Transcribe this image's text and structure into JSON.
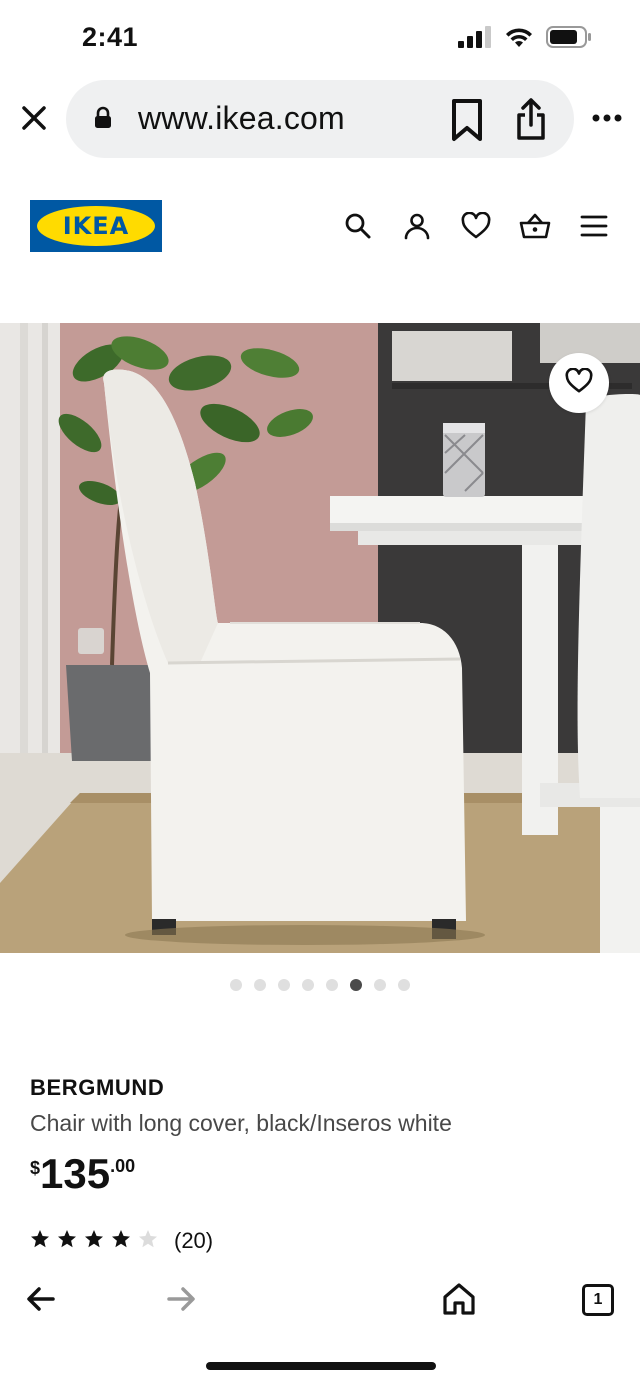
{
  "status": {
    "time": "2:41"
  },
  "browser": {
    "url": "www.ikea.com",
    "tab_count": "1"
  },
  "brand": {
    "logo_text": "IKEA",
    "logo_colors": {
      "blue": "#0058a3",
      "yellow": "#ffdb00"
    }
  },
  "header_icons": [
    "search-icon",
    "account-icon",
    "heart-icon",
    "cart-icon",
    "menu-icon"
  ],
  "carousel": {
    "total": 8,
    "active_index": 5
  },
  "product": {
    "name": "BERGMUND",
    "description": "Chair with long cover, black/Inseros white",
    "price": {
      "currency": "$",
      "whole": "135",
      "decimal": ".00"
    },
    "rating": {
      "stars": 4,
      "max": 5,
      "count_label": "(20)"
    }
  }
}
